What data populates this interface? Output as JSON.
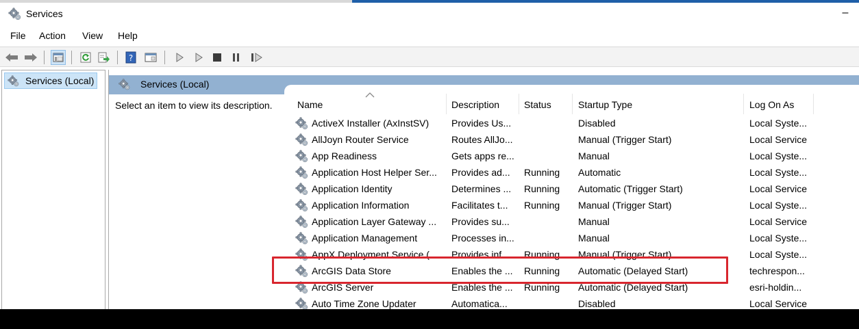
{
  "window": {
    "title": "Services",
    "minimize_glyph": "–"
  },
  "menu": {
    "items": [
      "File",
      "Action",
      "View",
      "Help"
    ]
  },
  "toolbar": {
    "icons": [
      "back-arrow-icon",
      "forward-arrow-icon",
      "show-hide-console-tree-icon",
      "refresh-icon",
      "export-list-icon",
      "help-icon",
      "properties-icon",
      "start-service-icon",
      "start-service-alt-icon",
      "stop-service-icon",
      "pause-service-icon",
      "restart-service-icon"
    ]
  },
  "tree": {
    "root_label": "Services (Local)"
  },
  "pane": {
    "header_title": "Services (Local)",
    "description_prompt": "Select an item to view its description."
  },
  "columns": {
    "name": "Name",
    "description": "Description",
    "status": "Status",
    "startup_type": "Startup Type",
    "log_on_as": "Log On As"
  },
  "services": [
    {
      "name": "ActiveX Installer (AxInstSV)",
      "description": "Provides Us...",
      "status": "",
      "startup_type": "Disabled",
      "log_on_as": "Local Syste..."
    },
    {
      "name": "AllJoyn Router Service",
      "description": "Routes AllJo...",
      "status": "",
      "startup_type": "Manual (Trigger Start)",
      "log_on_as": "Local Service"
    },
    {
      "name": "App Readiness",
      "description": "Gets apps re...",
      "status": "",
      "startup_type": "Manual",
      "log_on_as": "Local Syste..."
    },
    {
      "name": "Application Host Helper Ser...",
      "description": "Provides ad...",
      "status": "Running",
      "startup_type": "Automatic",
      "log_on_as": "Local Syste..."
    },
    {
      "name": "Application Identity",
      "description": "Determines ...",
      "status": "Running",
      "startup_type": "Automatic (Trigger Start)",
      "log_on_as": "Local Service"
    },
    {
      "name": "Application Information",
      "description": "Facilitates t...",
      "status": "Running",
      "startup_type": "Manual (Trigger Start)",
      "log_on_as": "Local Syste..."
    },
    {
      "name": "Application Layer Gateway ...",
      "description": "Provides su...",
      "status": "",
      "startup_type": "Manual",
      "log_on_as": "Local Service"
    },
    {
      "name": "Application Management",
      "description": "Processes in...",
      "status": "",
      "startup_type": "Manual",
      "log_on_as": "Local Syste..."
    },
    {
      "name": "AppX Deployment Service (...",
      "description": "Provides inf...",
      "status": "Running",
      "startup_type": "Manual (Trigger Start)",
      "log_on_as": "Local Syste..."
    },
    {
      "name": "ArcGIS Data Store",
      "description": "Enables the ...",
      "status": "Running",
      "startup_type": "Automatic (Delayed Start)",
      "log_on_as": "techrespon..."
    },
    {
      "name": "ArcGIS Server",
      "description": "Enables the ...",
      "status": "Running",
      "startup_type": "Automatic (Delayed Start)",
      "log_on_as": "esri-holdin..."
    },
    {
      "name": "Auto Time Zone Updater",
      "description": "Automatica...",
      "status": "",
      "startup_type": "Disabled",
      "log_on_as": "Local Service"
    }
  ],
  "colors": {
    "highlight": "#d8262e",
    "pane_header": "#92b1d1",
    "selection": "#cce4f7"
  }
}
